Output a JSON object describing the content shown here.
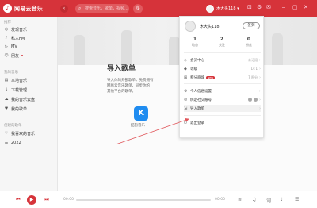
{
  "app": {
    "logo_char": "♪",
    "title": "网易云音乐"
  },
  "topbar": {
    "back": "‹",
    "forward": "›",
    "search_placeholder": "搜索音乐，歌单，视频...",
    "search_icon": "⌕",
    "mic_icon": "🎙",
    "username": "木大头118 ▾",
    "icons": [
      "⊡",
      "⚙",
      "✉",
      "⎯",
      "▢",
      "✕"
    ]
  },
  "sidebar": {
    "section1": "推荐",
    "items1": [
      {
        "icon": "◎",
        "label": "发现音乐"
      },
      {
        "icon": "♪",
        "label": "私人FM"
      },
      {
        "icon": "▷",
        "label": "MV"
      },
      {
        "icon": "☺",
        "label": "朋友"
      }
    ],
    "section2": "我的音乐",
    "items2": [
      {
        "icon": "▤",
        "label": "本地音乐"
      },
      {
        "icon": "↓",
        "label": "下载管理"
      },
      {
        "icon": "☁",
        "label": "我的音乐云盘"
      },
      {
        "icon": "♥",
        "label": "我的歌单"
      }
    ],
    "section3": "创建的歌单",
    "items3": [
      {
        "icon": "♡",
        "label": "我喜欢的音乐"
      },
      {
        "icon": "☰",
        "label": "2022"
      }
    ]
  },
  "main": {
    "title": "导入歌单",
    "desc_lines": [
      "导入你的外部歌单，免费拥有",
      "网易云音乐歌单，同步你的",
      "其他平台的歌单。"
    ],
    "kugou_char": "K",
    "kugou_label": "酷狗音乐"
  },
  "dropdown": {
    "name": "木大头118",
    "signin": "签到",
    "stats": [
      {
        "num": "1",
        "label": "动态"
      },
      {
        "num": "2",
        "label": "关注"
      },
      {
        "num": "0",
        "label": "粉丝"
      }
    ],
    "items": [
      {
        "icon": "◇",
        "label": "会员中心",
        "right": "未订阅"
      },
      {
        "icon": "◆",
        "label": "等级",
        "right": "Lv.1"
      },
      {
        "icon": "⊞",
        "label": "积分商城",
        "badge": "NEW",
        "right": "7 积分"
      },
      {
        "icon": "⚙",
        "label": "个人信息设置",
        "right": ""
      },
      {
        "icon": "⊘",
        "label": "绑定社交账号",
        "right": ""
      },
      {
        "icon": "⇲",
        "label": "导入歌单",
        "right": ""
      },
      {
        "icon": "⏻",
        "label": "退出登录",
        "right": ""
      }
    ],
    "chevron": "›"
  },
  "player": {
    "prev": "⏮",
    "play": "▶",
    "next": "⏭",
    "time_start": "00:00",
    "time_end": "00:00",
    "icons": [
      "≋",
      "♫",
      "词",
      "♩",
      "☰"
    ]
  }
}
